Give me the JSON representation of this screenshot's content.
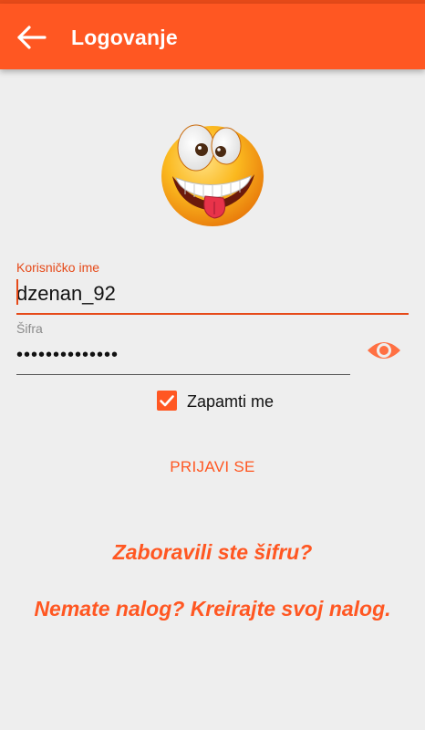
{
  "colors": {
    "primary": "#ff5722",
    "primary_dark": "#e64a19",
    "background": "#eeeeee"
  },
  "appbar": {
    "title": "Logovanje",
    "back_icon": "arrow-left-icon"
  },
  "avatar": {
    "icon": "crazy-emoji-face"
  },
  "username": {
    "label": "Korisničko ime",
    "value": "dzenan_92"
  },
  "password": {
    "label": "Šifra",
    "value": "password123456",
    "toggle_icon": "eye-icon"
  },
  "remember": {
    "label": "Zapamti me",
    "checked": true
  },
  "login_button": {
    "label": "PRIJAVI SE"
  },
  "links": {
    "forgot": "Zaboravili ste šifru?",
    "register": "Nemate nalog? Kreirajte svoj nalog."
  }
}
